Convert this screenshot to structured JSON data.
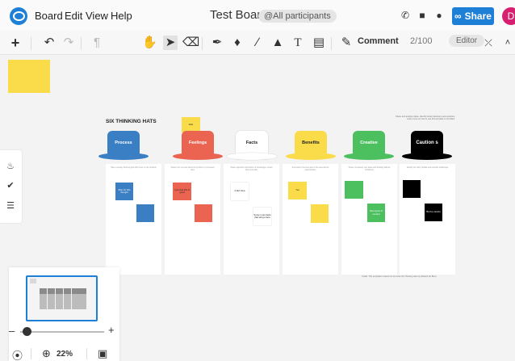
{
  "menubar": {
    "items": [
      "Board",
      "Edit",
      "View",
      "Help"
    ],
    "title": "Test Board",
    "participants": "@All participants",
    "share_label": "Share",
    "avatar_initial": "D"
  },
  "toolbar": {
    "comment_label": "Comment",
    "object_count": "2/100",
    "editor_label": "Editor"
  },
  "canvas": {
    "board_title": "SIX THINKING HATS",
    "top_note": "Share and analyze ideas. Identify better decisions and solutions. Learn more on how to use this template to its fullest.",
    "small_note": "hello",
    "footer_credit": "Credit: This template is based on the book Six Thinking Hats by Edward de Bono",
    "hats": [
      {
        "label": "Process",
        "color": "#3a7fc4"
      },
      {
        "label": "Feelings",
        "color": "#ea6451"
      },
      {
        "label": "Facts",
        "color": "#ffffff"
      },
      {
        "label": "Benefits",
        "color": "#fadc4b"
      },
      {
        "label": "Creative",
        "color": "#4cbf5f"
      },
      {
        "label": "Caution s",
        "color": "#000000"
      }
    ],
    "columns": [
      {
        "instructions": "Have a clearly defined goal with focus on the problem",
        "notes": [
          "Plan for this thought",
          ""
        ]
      },
      {
        "instructions": "Share how you feel about the problem or proposed idea",
        "notes": [
          "I just feel this is great",
          ""
        ]
      },
      {
        "instructions": "Share objective information or knowledge, known facts and data",
        "notes": [
          "A fact here",
          "Some more facts that will go here"
        ]
      },
      {
        "instructions": "Summarize the best side of the idea and its opportunities",
        "notes": [
          "Yes",
          ""
        ]
      },
      {
        "instructions": "Share completely new ideas and thinking without limitations",
        "notes": [
          "",
          "New types of content"
        ]
      },
      {
        "instructions": "Identify the risks, pitfalls and possible challenges",
        "notes": [
          "",
          "But be careful"
        ]
      }
    ]
  },
  "minimap": {
    "zoom_percent": "22%"
  },
  "colors": {
    "brand": "#1d7fd6",
    "avatar": "#d6206f",
    "sticky_yellow": "#fadc4b"
  }
}
